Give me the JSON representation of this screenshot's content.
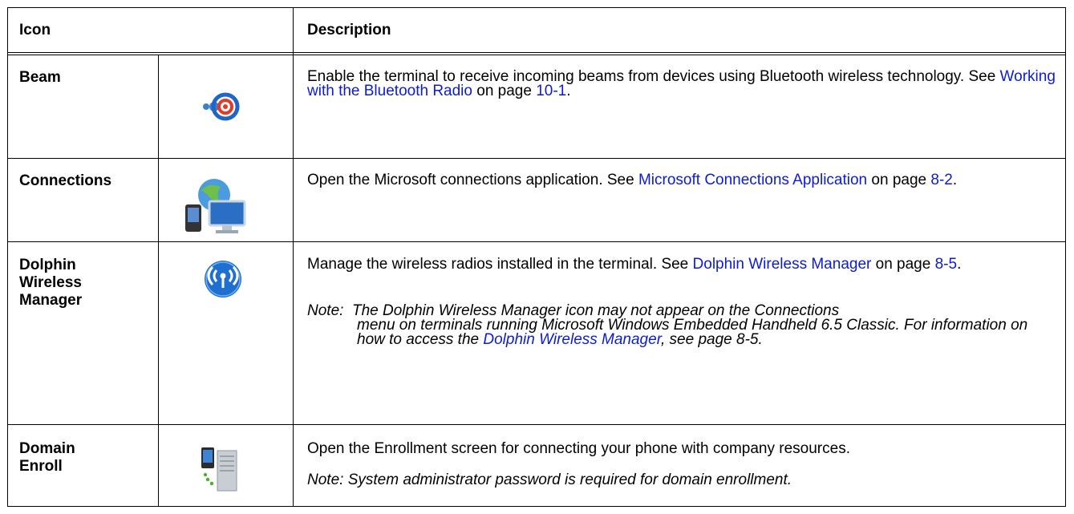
{
  "table": {
    "headers": {
      "icon": "Icon",
      "description": "Description"
    },
    "rows": [
      {
        "name": "Beam",
        "icon": "beam-icon",
        "desc": {
          "t1": "Enable the terminal to receive incoming beams from devices using Bluetooth wireless technology. See ",
          "link1": "Working with the Bluetooth Radio",
          "t2": " on page ",
          "link2": "10-1",
          "t3": "."
        }
      },
      {
        "name": "Connections",
        "icon": "connections-icon",
        "desc": {
          "t1": "Open the Microsoft connections application. See ",
          "link1": "Microsoft Connections Application",
          "t2": " on page ",
          "link2": "8-2",
          "t3": "."
        }
      },
      {
        "name_lines": [
          "Dolphin",
          "Wireless",
          "Manager"
        ],
        "icon": "wireless-radio-icon",
        "desc": {
          "t1": "Manage the wireless radios installed in the terminal. See ",
          "link1": "Dolphin Wireless Manager",
          "t2": " on page ",
          "link2": "8-5",
          "t3": "."
        },
        "note": {
          "prefix": "Note:",
          "t1": "The Dolphin Wireless Manager icon may not appear on the Connections",
          "t2": "menu on terminals running Microsoft Windows Embedded Handheld 6.5 Classic. For information on how to access the ",
          "link": "Dolphin Wireless Manager",
          "t3": ", see page 8-5."
        }
      },
      {
        "name_lines": [
          "Domain",
          "Enroll"
        ],
        "icon": "domain-enroll-icon",
        "desc": {
          "t1": "Open the Enrollment screen for connecting your phone with company resources."
        },
        "note": {
          "text": "Note: System administrator password is required for domain enrollment."
        }
      }
    ]
  },
  "colors": {
    "link": "#0b1bd8",
    "border": "#000000"
  }
}
